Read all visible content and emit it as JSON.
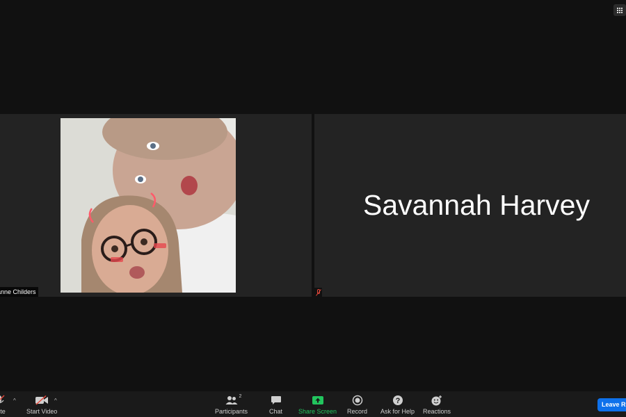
{
  "meeting": {
    "view_button": "gallery-view"
  },
  "participants": [
    {
      "name": "ianne Childers",
      "video": "on"
    },
    {
      "name": "Savannah Harvey",
      "video": "off",
      "muted": true
    }
  ],
  "toolbar": {
    "mute_label": "nute",
    "start_video_label": "Start Video",
    "participants_label": "Participants",
    "participants_count": "2",
    "chat_label": "Chat",
    "share_label": "Share Screen",
    "record_label": "Record",
    "help_label": "Ask for Help",
    "reactions_label": "Reactions",
    "leave_label": "Leave Ro"
  },
  "colors": {
    "background": "#111111",
    "tile": "#232323",
    "share_green": "#22c55e",
    "leave_blue": "#0e71eb",
    "muted_red": "#e5483b"
  }
}
